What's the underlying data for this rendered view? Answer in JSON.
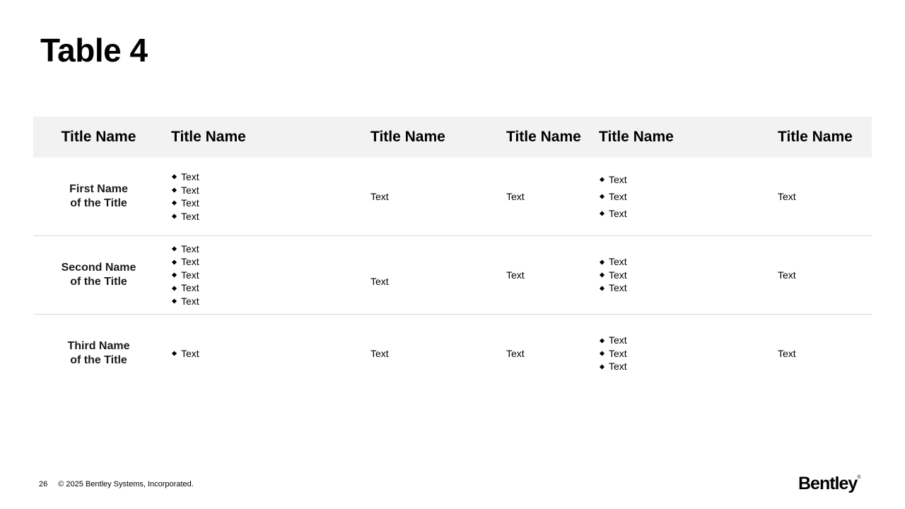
{
  "slide": {
    "title": "Table 4"
  },
  "table": {
    "headers": [
      "Title Name",
      "Title Name",
      "Title Name",
      "Title Name",
      "Title Name",
      "Title Name"
    ],
    "rows": [
      {
        "name_line1": "First Name",
        "name_line2": "of the Title",
        "col2": [
          "Text",
          "Text",
          "Text",
          "Text"
        ],
        "col3": "Text",
        "col4": "Text",
        "col5": [
          "Text",
          "Text",
          "Text"
        ],
        "col6": "Text"
      },
      {
        "name_line1": "Second Name",
        "name_line2": "of the Title",
        "col2": [
          "Text",
          "Text",
          "Text",
          "Text",
          "Text"
        ],
        "col3": "Text",
        "col4": "Text",
        "col5": [
          "Text",
          "Text",
          "Text"
        ],
        "col6": "Text"
      },
      {
        "name_line1": "Third Name",
        "name_line2": "of the Title",
        "col2": [
          "Text"
        ],
        "col3": "Text",
        "col4": "Text",
        "col5": [
          "Text",
          "Text",
          "Text"
        ],
        "col6": "Text"
      }
    ]
  },
  "footer": {
    "page_number": "26",
    "copyright": "© 2025 Bentley Systems, Incorporated."
  },
  "logo": {
    "text": "Bentley",
    "mark": "®"
  }
}
